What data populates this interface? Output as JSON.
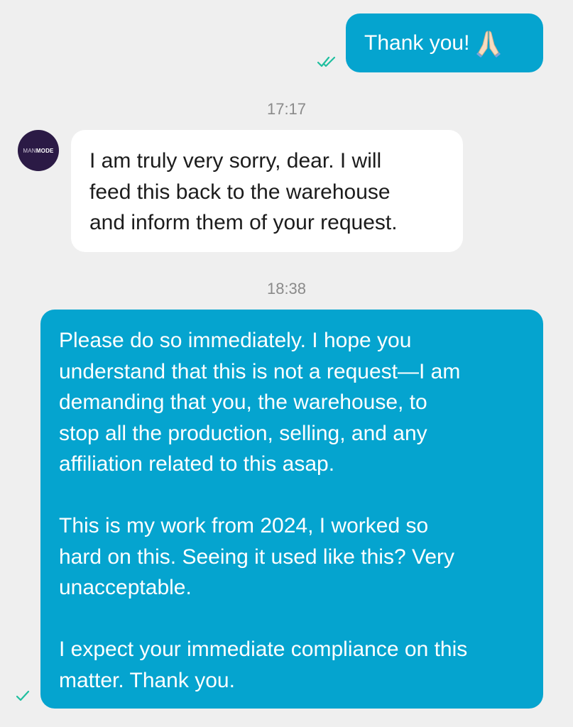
{
  "brand": {
    "prefix": "MAN",
    "suffix": "MODE"
  },
  "colors": {
    "outgoing_bubble": "#05a4cf",
    "incoming_bubble": "#ffffff",
    "background": "#efefef",
    "check": "#1fbf9f"
  },
  "messages": [
    {
      "direction": "outgoing",
      "text": "Thank you!",
      "emoji": "folded-hands",
      "status": "read"
    },
    {
      "timestamp": "17:17"
    },
    {
      "direction": "incoming",
      "lines": [
        "I am truly very sorry, dear. I will",
        "feed this back to the warehouse",
        "and inform them of your request."
      ]
    },
    {
      "timestamp": "18:38"
    },
    {
      "direction": "outgoing",
      "status": "sent",
      "paragraphs": [
        [
          "Please do so immediately. I hope you",
          "understand that this is not a request—I am",
          "demanding that you, the warehouse, to",
          "stop all the production, selling, and any",
          "affiliation related to this asap."
        ],
        [
          "This is my work from 2024, I worked so",
          "hard on this. Seeing it used like this? Very",
          "unacceptable."
        ],
        [
          "I expect your immediate compliance on this",
          "matter. Thank you."
        ]
      ]
    }
  ]
}
